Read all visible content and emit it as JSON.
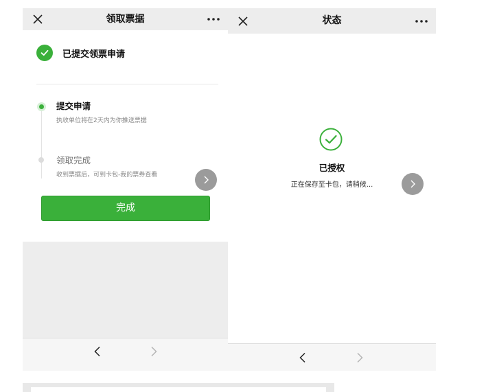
{
  "left_screen": {
    "topbar": {
      "title": "领取票据",
      "close_icon": "close-icon",
      "more_icon": "more-dots-icon"
    },
    "header": {
      "icon": "check-circle-icon",
      "text": "已提交领票申请"
    },
    "steps": [
      {
        "title": "提交申请",
        "description": "执收单位将在2天内为你推送票据",
        "state": "active"
      },
      {
        "title": "领取完成",
        "description": "收到票据后，可到卡包-我的票券查看",
        "state": "pending"
      }
    ],
    "primary_button": {
      "label": "完成"
    },
    "next_icon": "chevron-right-icon",
    "bottombar": {
      "back_icon": "chevron-left-icon",
      "forward_icon": "chevron-right-icon"
    }
  },
  "right_screen": {
    "topbar": {
      "title": "状态",
      "close_icon": "close-icon",
      "more_icon": "more-dots-icon"
    },
    "status": {
      "icon": "check-circle-outline-icon",
      "title": "已授权",
      "description": "正在保存至卡包，请稍候..."
    },
    "next_icon": "chevron-right-icon",
    "bottombar": {
      "back_icon": "chevron-left-icon",
      "forward_icon": "chevron-right-icon"
    }
  },
  "colors": {
    "accent_green": "#3ab03a",
    "topbar_bg": "#ededed",
    "arrow_bg": "#9b9b9b",
    "nav_active": "#222222",
    "nav_disabled": "#b5b5b5"
  }
}
